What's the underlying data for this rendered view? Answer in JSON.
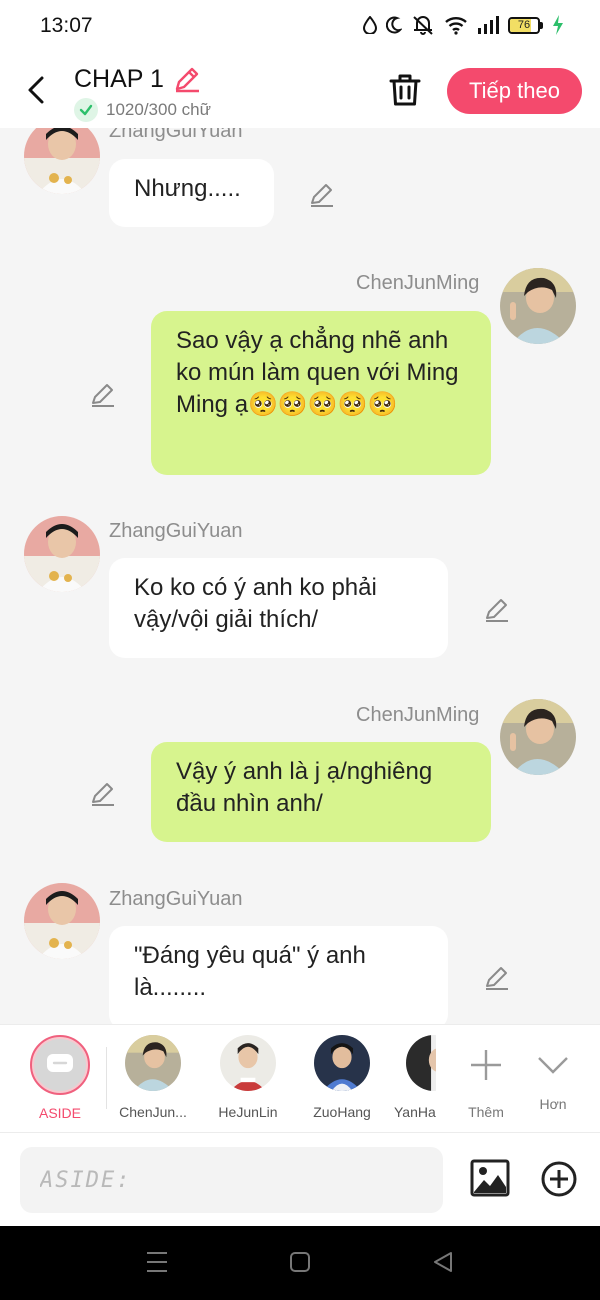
{
  "status_bar": {
    "time": "13:07",
    "battery": "76"
  },
  "header": {
    "chapter_title": "CHAP 1",
    "word_count": "1020/300 chữ",
    "next_label": "Tiếp theo"
  },
  "messages": [
    {
      "sender": "ZhangGuiYuan",
      "text": "Nhưng....."
    },
    {
      "sender": "ChenJunMing",
      "text": "Sao vậy ạ chẳng nhẽ anh ko mún làm quen với Ming Ming ạ🥺🥺🥺🥺🥺"
    },
    {
      "sender": "ZhangGuiYuan",
      "text": "Ko ko có ý anh ko phải vậy/vội giải thích/"
    },
    {
      "sender": "ChenJunMing",
      "text": "Vậy ý anh là j ạ/nghiêng đầu nhìn anh/"
    },
    {
      "sender": "ZhangGuiYuan",
      "text": "\"Đáng yêu quá\" ý anh là........"
    }
  ],
  "characters": {
    "aside_label": "ASIDE",
    "items": [
      {
        "label": "ChenJun..."
      },
      {
        "label": "HeJunLin"
      },
      {
        "label": "ZuoHang"
      },
      {
        "label": "YanHa"
      }
    ],
    "add_label": "Thêm",
    "more_label": "Hơn"
  },
  "input": {
    "placeholder": "ASIDE:"
  },
  "colors": {
    "accent": "#f44a6d",
    "right_bubble": "#d7f48e",
    "left_bubble": "#ffffff"
  }
}
